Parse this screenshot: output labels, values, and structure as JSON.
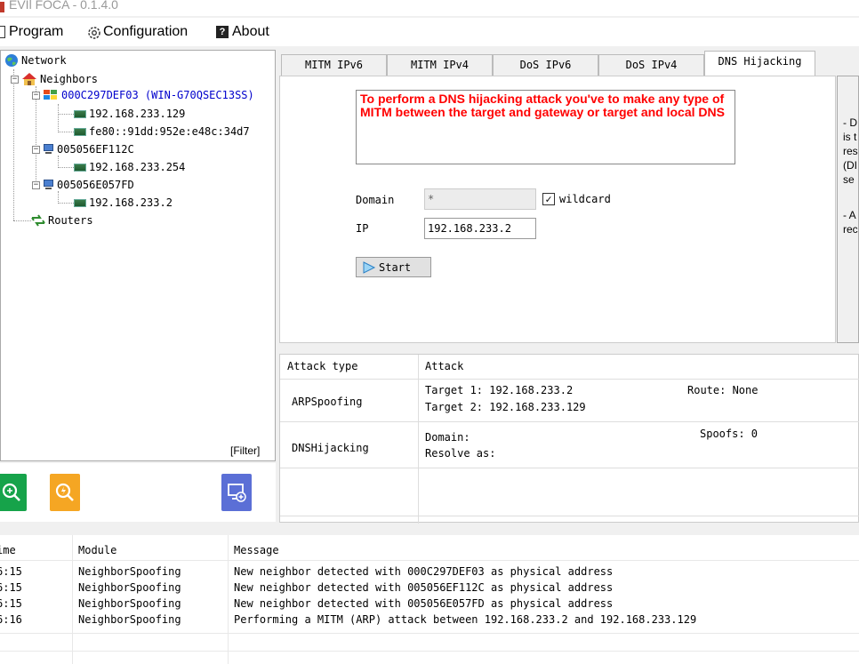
{
  "window": {
    "title": "EVIl FOCA - 0.1.4.0"
  },
  "menu": {
    "program": "Program",
    "configuration": "Configuration",
    "about": "About"
  },
  "tree": {
    "network": "Network",
    "neighbors": "Neighbors",
    "host1": {
      "label": "000C297DEF03 (WIN-G70QSEC13SS)",
      "ip4": "192.168.233.129",
      "ip6": "fe80::91dd:952e:e48c:34d7"
    },
    "host2": {
      "label": "005056EF112C",
      "ip4": "192.168.233.254"
    },
    "host3": {
      "label": "005056E057FD",
      "ip4": "192.168.233.2"
    },
    "routers": "Routers",
    "filter": "[Filter]"
  },
  "tabs": [
    "MITM IPv6",
    "MITM IPv4",
    "DoS IPv6",
    "DoS IPv4",
    "DNS Hijacking"
  ],
  "dns_hijacking": {
    "warning": "To perform a DNS hijacking attack you've to make any type of MITM between the target and gateway or target and local DNS",
    "domain_label": "Domain",
    "domain_value": "*",
    "wildcard_label": "wildcard",
    "ip_label": "IP",
    "ip_value": "192.168.233.2",
    "start_label": "Start"
  },
  "help_fragments": [
    "- D",
    "is t",
    "res",
    "(DI",
    "se",
    "- A",
    "rec"
  ],
  "attack_table": {
    "headers": {
      "type": "Attack type",
      "attack": "Attack"
    },
    "rows": [
      {
        "type": "ARPSpoofing",
        "line1": "Target 1: 192.168.233.2",
        "line2": "Target 2: 192.168.233.129",
        "extra": "Route: None"
      },
      {
        "type": "DNSHijacking",
        "line1": "Domain:",
        "line2": "Resolve as:",
        "extra": "Spoofs: 0"
      }
    ]
  },
  "log": {
    "headers": {
      "time": "ime",
      "module": "Module",
      "message": "Message"
    },
    "rows": [
      {
        "time": "6:15",
        "module": "NeighborSpoofing",
        "message": "New neighbor detected with 000C297DEF03 as physical address"
      },
      {
        "time": "6:15",
        "module": "NeighborSpoofing",
        "message": "New neighbor detected with 005056EF112C as physical address"
      },
      {
        "time": "6:15",
        "module": "NeighborSpoofing",
        "message": "New neighbor detected with 005056E057FD as physical address"
      },
      {
        "time": "6:16",
        "module": "NeighborSpoofing",
        "message": "Performing a MITM (ARP) attack between 192.168.233.2 and 192.168.233.129"
      }
    ]
  },
  "colors": {
    "warning_text": "#ff0000",
    "host_highlight": "#0000cc",
    "scan_button": "#16a34a",
    "spoof_button": "#f5a623",
    "add_button": "#5b6fd6"
  }
}
